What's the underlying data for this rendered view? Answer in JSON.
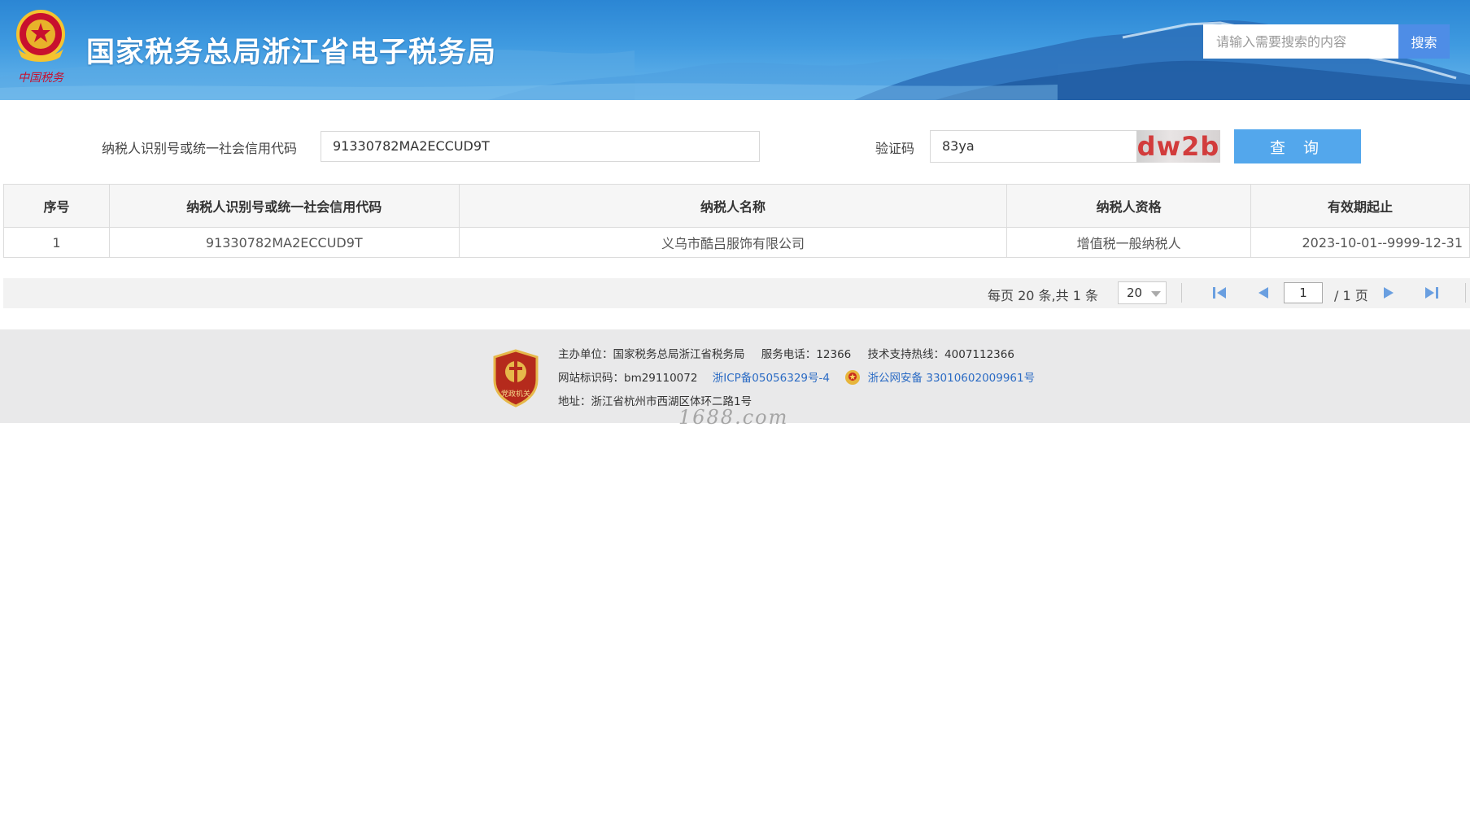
{
  "header": {
    "site_title": "国家税务总局浙江省电子税务局",
    "emblem_caption": "中国税务",
    "search_placeholder": "请输入需要搜索的内容",
    "search_button": "搜索"
  },
  "query_form": {
    "taxpayer_id_label": "纳税人识别号或统一社会信用代码",
    "taxpayer_id_value": "91330782MA2ECCUD9T",
    "captcha_label": "验证码",
    "captcha_value": "83ya",
    "captcha_image_text": "dw2b",
    "query_button": "查 询"
  },
  "results_table": {
    "columns": [
      "序号",
      "纳税人识别号或统一社会信用代码",
      "纳税人名称",
      "纳税人资格",
      "有效期起止"
    ],
    "rows": [
      [
        "1",
        "91330782MA2ECCUD9T",
        "义乌市酷吕服饰有限公司",
        "增值税一般纳税人",
        "2023-10-01--9999-12-31"
      ]
    ]
  },
  "pagination": {
    "summary": "每页 20 条,共 1 条",
    "page_size": "20",
    "current_page": "1",
    "total_pages": "/ 1 页"
  },
  "footer": {
    "badge_caption": "党政机关",
    "sponsor": "主办单位：国家税务总局浙江省税务局",
    "service_phone": "服务电话：12366",
    "tech_hotline": "技术支持热线：4007112366",
    "site_id": "网站标识码：bm29110072",
    "icp": "浙ICP备05056329号-4",
    "police_record": "浙公网安备 33010602009961号",
    "address": "地址：浙江省杭州市西湖区体环二路1号"
  },
  "watermark": "1688.com",
  "colors": {
    "header_blue": "#3f9ae0",
    "search_button": "#4e8de6",
    "query_button": "#53a7ec",
    "captcha_text": "#d23c3c",
    "link": "#2b6bc4",
    "pager_icon": "#6a9fe0"
  }
}
